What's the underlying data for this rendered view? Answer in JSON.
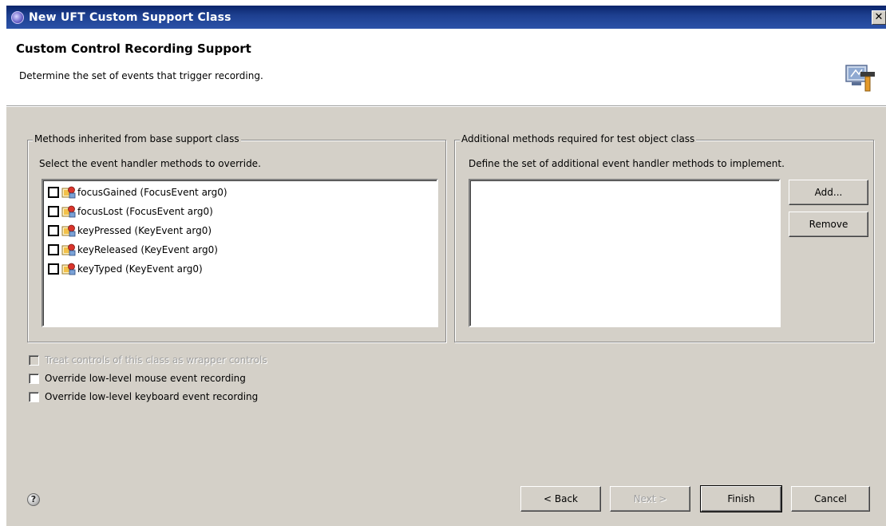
{
  "window": {
    "title": "New UFT Custom Support Class",
    "close_glyph": "✕"
  },
  "header": {
    "title": "Custom Control Recording Support",
    "description": "Determine the set of events that trigger recording."
  },
  "inherited_group": {
    "legend": "Methods inherited from base support class",
    "instruction": "Select the event handler methods to override.",
    "methods": [
      {
        "label": "focusGained (FocusEvent arg0)",
        "checked": false
      },
      {
        "label": "focusLost (FocusEvent arg0)",
        "checked": false
      },
      {
        "label": "keyPressed (KeyEvent arg0)",
        "checked": false
      },
      {
        "label": "keyReleased (KeyEvent arg0)",
        "checked": false
      },
      {
        "label": "keyTyped (KeyEvent arg0)",
        "checked": false
      }
    ]
  },
  "additional_group": {
    "legend": "Additional methods required for test object class",
    "instruction": "Define the set of additional event handler methods to implement.",
    "add_label": "Add...",
    "remove_label": "Remove"
  },
  "options": {
    "wrapper": {
      "label": "Treat controls of this class as wrapper controls",
      "enabled": false,
      "checked": false
    },
    "mouse": {
      "label": "Override low-level mouse event recording",
      "enabled": true,
      "checked": false
    },
    "keyboard": {
      "label": "Override low-level keyboard event recording",
      "enabled": true,
      "checked": false
    }
  },
  "footer": {
    "help_glyph": "?",
    "back_label": "< Back",
    "next_label": "Next >",
    "finish_label": "Finish",
    "cancel_label": "Cancel"
  },
  "icons": {
    "app": "eclipse-icon",
    "wizard": "wizard-banner-icon",
    "method": "method-event-icon",
    "help": "help-icon"
  }
}
